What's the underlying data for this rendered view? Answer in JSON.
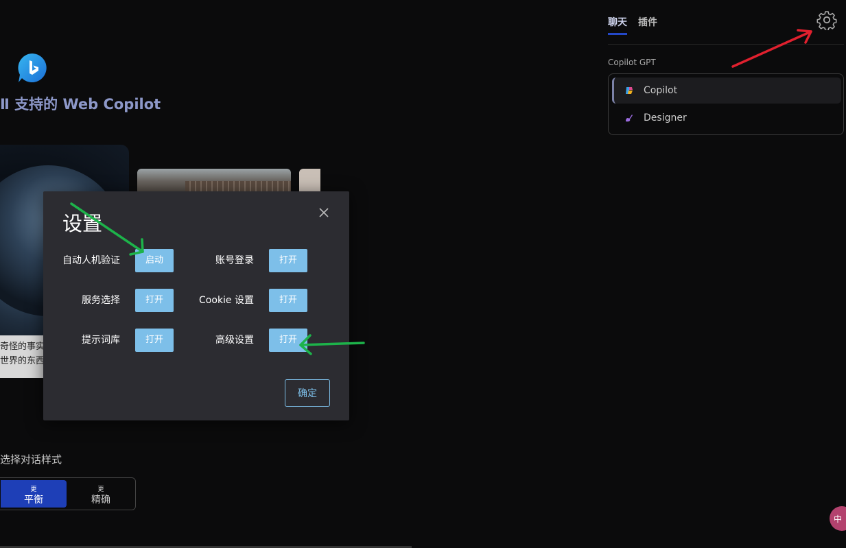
{
  "hero": {
    "title": "Ⅱ 支持的 Web Copilot",
    "card_caption_line1": "奇怪的事实",
    "card_caption_line2": "世界的东西"
  },
  "conversation_style": {
    "label": "选择对话样式",
    "options": [
      {
        "more": "更",
        "label": "平衡",
        "active": true
      },
      {
        "more": "更",
        "label": "精确",
        "active": false
      }
    ]
  },
  "right_panel": {
    "tabs": [
      {
        "label": "聊天",
        "active": true
      },
      {
        "label": "插件",
        "active": false
      }
    ],
    "gpt_heading": "Copilot GPT",
    "gpts": [
      {
        "label": "Copilot",
        "icon": "copilot-icon",
        "active": true
      },
      {
        "label": "Designer",
        "icon": "designer-icon",
        "active": false
      }
    ]
  },
  "floating_badge": {
    "text": "中"
  },
  "settings_modal": {
    "title": "设置",
    "rows": [
      {
        "left_label": "自动人机验证",
        "left_button": "启动",
        "right_label": "账号登录",
        "right_button": "打开"
      },
      {
        "left_label": "服务选择",
        "left_button": "打开",
        "right_label": "Cookie 设置",
        "right_button": "打开"
      },
      {
        "left_label": "提示词库",
        "left_button": "打开",
        "right_label": "高级设置",
        "right_button": "打开"
      }
    ],
    "confirm_label": "确定"
  },
  "colors": {
    "accent_blue": "#1e3fb7",
    "button_blue": "#7dbfe9",
    "annotation_red": "#e0202e",
    "annotation_green": "#1db34a"
  }
}
